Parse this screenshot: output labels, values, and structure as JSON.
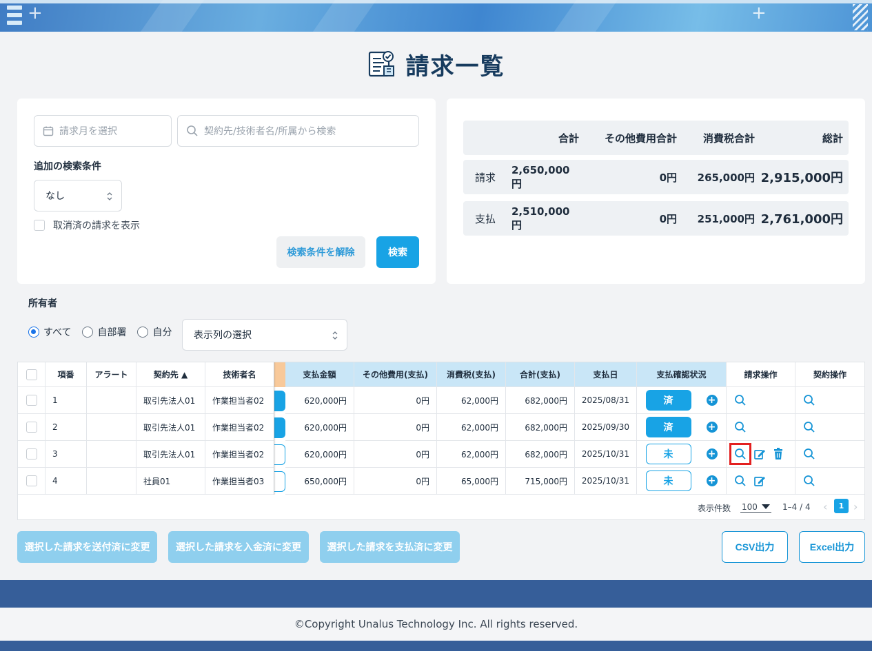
{
  "page": {
    "title": "請求一覧"
  },
  "search": {
    "month_placeholder": "請求月を選択",
    "keyword_placeholder": "契約先/技術者名/所属から検索",
    "additional_label": "追加の検索条件",
    "additional_value": "なし",
    "show_cancelled_label": "取消済の請求を表示",
    "clear_label": "検索条件を解除",
    "search_label": "検索"
  },
  "summary": {
    "headers": [
      "合計",
      "その他費用合計",
      "消費税合計",
      "総計"
    ],
    "rows": [
      {
        "label": "請求",
        "total": "2,650,000円",
        "other": "0円",
        "tax": "265,000円",
        "grand": "2,915,000円"
      },
      {
        "label": "支払",
        "total": "2,510,000円",
        "other": "0円",
        "tax": "251,000円",
        "grand": "2,761,000円"
      }
    ]
  },
  "owner": {
    "label": "所有者",
    "options": [
      "すべて",
      "自部署",
      "自分"
    ],
    "selected": "すべて",
    "column_select": "表示列の選択"
  },
  "grid": {
    "headers": {
      "no": "項番",
      "alert": "アラート",
      "client": "契約先 ▲",
      "engineer": "技術者名",
      "pay_amount": "支払金額",
      "pay_other": "その他費用(支払)",
      "pay_tax": "消費税(支払)",
      "pay_total": "合計(支払)",
      "pay_date": "支払日",
      "pay_status": "支払確認状況",
      "invoice_ops": "請求操作",
      "contract_ops": "契約操作"
    },
    "rows": [
      {
        "no": "1",
        "alert": "",
        "client": "取引先法人01",
        "engineer": "作業担当者02",
        "pay_amount": "620,000円",
        "pay_other": "0円",
        "pay_tax": "62,000円",
        "pay_total": "682,000円",
        "pay_date": "2025/08/31",
        "status": "済"
      },
      {
        "no": "2",
        "alert": "",
        "client": "取引先法人01",
        "engineer": "作業担当者02",
        "pay_amount": "620,000円",
        "pay_other": "0円",
        "pay_tax": "62,000円",
        "pay_total": "682,000円",
        "pay_date": "2025/09/30",
        "status": "済"
      },
      {
        "no": "3",
        "alert": "",
        "client": "取引先法人01",
        "engineer": "作業担当者02",
        "pay_amount": "620,000円",
        "pay_other": "0円",
        "pay_tax": "62,000円",
        "pay_total": "682,000円",
        "pay_date": "2025/10/31",
        "status": "未"
      },
      {
        "no": "4",
        "alert": "",
        "client": "社員01",
        "engineer": "作業担当者03",
        "pay_amount": "650,000円",
        "pay_other": "0円",
        "pay_tax": "65,000円",
        "pay_total": "715,000円",
        "pay_date": "2025/10/31",
        "status": "未"
      }
    ],
    "footer": {
      "per_page_label": "表示件数",
      "per_page_value": "100",
      "range": "1–4 / 4",
      "page": "1"
    }
  },
  "actions": {
    "mark_sent": "選択した請求を送付済に変更",
    "mark_received": "選択した請求を入金済に変更",
    "mark_paid": "選択した請求を支払済に変更",
    "csv": "CSV出力",
    "excel": "Excel出力"
  },
  "footer": {
    "copyright": "©Copyright Unalus Technology Inc. All rights reserved."
  },
  "colors": {
    "accent": "#18a3e5",
    "band": "#365e99",
    "title": "#173b5e",
    "highlight": "#e32020"
  }
}
